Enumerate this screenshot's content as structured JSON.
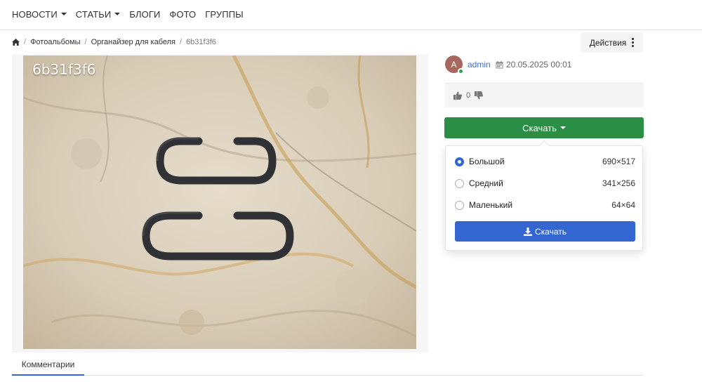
{
  "nav": [
    {
      "label": "Новости",
      "dropdown": true
    },
    {
      "label": "Статьи",
      "dropdown": true
    },
    {
      "label": "Блоги",
      "dropdown": false
    },
    {
      "label": "Фото",
      "dropdown": false
    },
    {
      "label": "Группы",
      "dropdown": false
    }
  ],
  "breadcrumb": {
    "items": [
      "Фотоальбомы",
      "Органайзер для кабеля"
    ],
    "current": "6b31f3f6"
  },
  "actions_label": "Действия",
  "photo": {
    "title": "6b31f3f6"
  },
  "meta": {
    "avatar_letter": "A",
    "author": "admin",
    "date": "20.05.2025 00:01"
  },
  "rating": {
    "count": "0"
  },
  "download": {
    "button_label": "Скачать",
    "options": [
      {
        "label": "Большой",
        "size": "690×517",
        "selected": true
      },
      {
        "label": "Средний",
        "size": "341×256",
        "selected": false
      },
      {
        "label": "Маленький",
        "size": "64×64",
        "selected": false
      }
    ],
    "submit_label": "Скачать"
  },
  "tabs": {
    "comments": "Комментарии"
  },
  "colors": {
    "green": "#2a8f45",
    "blue": "#3466d2",
    "link": "#3a6fd0"
  }
}
